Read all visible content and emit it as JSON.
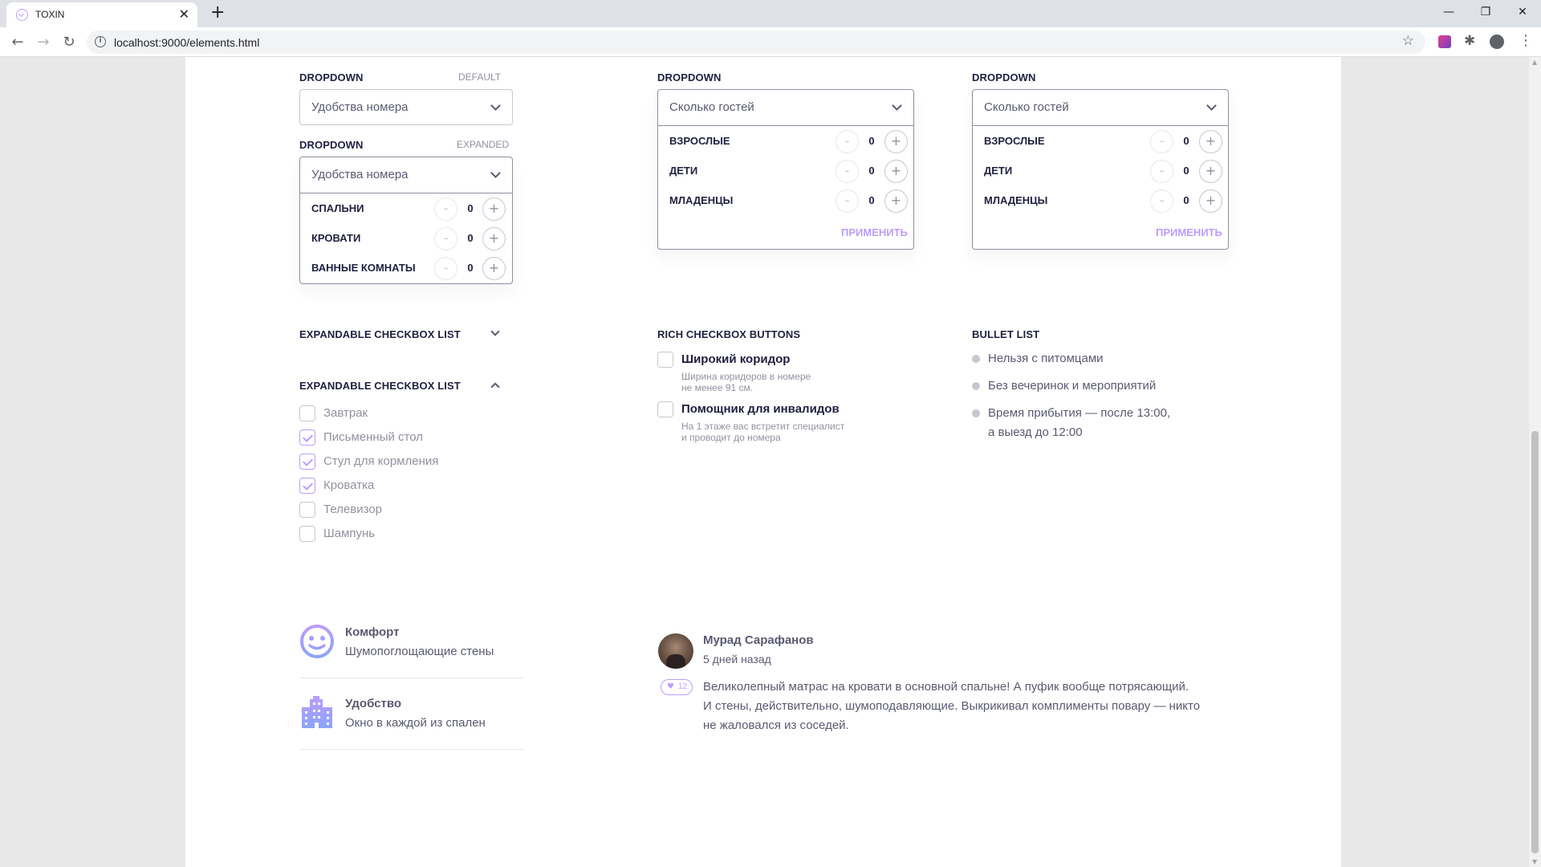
{
  "browser": {
    "tab_title": "TOXIN",
    "tab_close": "✕",
    "new_tab": "+",
    "url": "localhost:9000/elements.html",
    "back": "←",
    "forward": "→",
    "reload": "↻",
    "star": "☆",
    "extensions": "✱",
    "menu": "⋮",
    "minimize": "—",
    "restore": "❐",
    "close": "✕"
  },
  "dropdowns": {
    "title": "Dropdown",
    "default_hint": "default",
    "expanded_hint": "expanded",
    "amenities_placeholder": "Удобства номера",
    "guests_placeholder": "Сколько гостей",
    "apply_label": "Применить",
    "rooms": [
      {
        "label": "Спальни",
        "minus": "-",
        "value": "0",
        "plus": "+"
      },
      {
        "label": "Кровати",
        "minus": "-",
        "value": "0",
        "plus": "+"
      },
      {
        "label": "Ванные комнаты",
        "minus": "-",
        "value": "0",
        "plus": "+"
      }
    ],
    "guests_a": [
      {
        "label": "Взрослые",
        "minus": "-",
        "value": "0",
        "plus": "+"
      },
      {
        "label": "Дети",
        "minus": "-",
        "value": "0",
        "plus": "+"
      },
      {
        "label": "Младенцы",
        "minus": "-",
        "value": "0",
        "plus": "+"
      }
    ],
    "guests_b": [
      {
        "label": "Взрослые",
        "minus": "-",
        "value": "0",
        "plus": "+"
      },
      {
        "label": "Дети",
        "minus": "-",
        "value": "0",
        "plus": "+"
      },
      {
        "label": "Младенцы",
        "minus": "-",
        "value": "0",
        "plus": "+"
      }
    ]
  },
  "checkbox_lists": {
    "collapsed_title": "Expandable checkbox list",
    "expanded_title": "Expandable checkbox list",
    "items": [
      {
        "label": "Завтрак",
        "checked": false
      },
      {
        "label": "Письменный стол",
        "checked": true
      },
      {
        "label": "Стул для кормления",
        "checked": true
      },
      {
        "label": "Кроватка",
        "checked": true
      },
      {
        "label": "Телевизор",
        "checked": false
      },
      {
        "label": "Шампунь",
        "checked": false
      }
    ]
  },
  "rich_checkboxes": {
    "title": "Rich checkbox buttons",
    "items": [
      {
        "title": "Широкий коридор",
        "line1": "Ширина коридоров в номере",
        "line2": "не менее 91 см."
      },
      {
        "title": "Помощник для инвалидов",
        "line1": "На 1 этаже вас встретит специалист",
        "line2": "и проводит до номера"
      }
    ]
  },
  "bullet_list": {
    "title": "Bullet list",
    "items": [
      {
        "line1": "Нельзя с питомцами",
        "line2": ""
      },
      {
        "line1": "Без вечеринок и мероприятий",
        "line2": ""
      },
      {
        "line1": "Время прибытия — после 13:00,",
        "line2": "а выезд до 12:00"
      }
    ]
  },
  "features": [
    {
      "icon": "smile-icon",
      "title": "Комфорт",
      "desc": "Шумопоглощающие стены"
    },
    {
      "icon": "city-icon",
      "title": "Удобство",
      "desc": "Окно в каждой из спален"
    }
  ],
  "review": {
    "author": "Мурад Сарафанов",
    "date": "5 дней назад",
    "likes": "12",
    "heart": "♥",
    "line1": "Великолепный матрас на кровати в основной спальне! А пуфик вообще потрясающий.",
    "line2": "И стены, действительно, шумоподавляющие. Выкрикивал комплименты повару — никто",
    "line3": "не жаловался из соседей."
  },
  "colors": {
    "accent": "#bc9cff",
    "dark": "#1f2041",
    "icon_gradient_start": "#bc9cff",
    "icon_gradient_end": "#8ba4f9"
  }
}
